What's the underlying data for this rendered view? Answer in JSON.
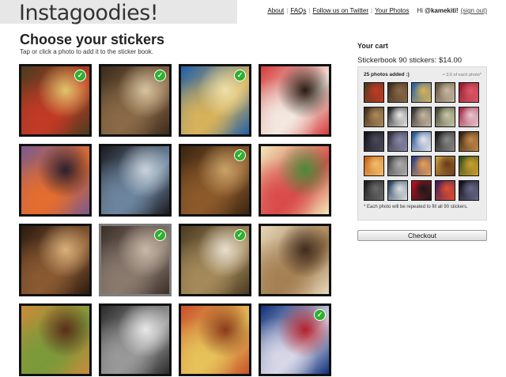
{
  "header": {
    "logo": "Instagoodies!",
    "nav": [
      {
        "label": "About"
      },
      {
        "label": "FAQs"
      },
      {
        "label": "Follow us on Twitter"
      },
      {
        "label": "Your Photos"
      }
    ],
    "greeting": "Hi ",
    "username": "@kamekiti!",
    "signout": "(sign out)"
  },
  "main": {
    "title": "Choose your stickers",
    "subtitle": "Tap or click a photo to add it to the sticker book."
  },
  "photos": [
    {
      "icon": "food-plate-photo",
      "colors": [
        "#4a3b1f",
        "#c23a25",
        "#e2c46b"
      ],
      "selected": true
    },
    {
      "icon": "people-street-photo",
      "colors": [
        "#3b2a1b",
        "#8a6a47",
        "#d8c3a0"
      ],
      "selected": true
    },
    {
      "icon": "blue-pen-box-photo",
      "colors": [
        "#1f5fa8",
        "#d8b35a",
        "#efe0a8"
      ],
      "selected": true
    },
    {
      "icon": "strawberry-dessert-photo",
      "colors": [
        "#d63a3a",
        "#f2e9e0",
        "#2a1a12"
      ],
      "selected": false
    },
    {
      "icon": "toy-figures-photo",
      "colors": [
        "#7b5a8c",
        "#e46d2e",
        "#2a1f2f"
      ],
      "selected": false
    },
    {
      "icon": "coffee-cup-photo",
      "colors": [
        "#1a1a20",
        "#6d86a0",
        "#c9d3dc"
      ],
      "selected": false
    },
    {
      "icon": "steak-dinner-photo",
      "colors": [
        "#3a2412",
        "#8d5a2a",
        "#c9a36a"
      ],
      "selected": true
    },
    {
      "icon": "floral-pattern-photo",
      "colors": [
        "#f1e9b8",
        "#d94a4a",
        "#4a8a3a"
      ],
      "selected": false
    },
    {
      "icon": "restaurant-interior-photo",
      "colors": [
        "#2b1a10",
        "#8a5a32",
        "#d9b07a"
      ],
      "selected": false
    },
    {
      "icon": "hallway-photo",
      "colors": [
        "#3a2e28",
        "#8a7a6e",
        "#c8b8a8"
      ],
      "selected": true
    },
    {
      "icon": "heart-note-photo",
      "colors": [
        "#4a3a22",
        "#a58a5a",
        "#e8e0d0"
      ],
      "selected": true
    },
    {
      "icon": "window-girl-photo",
      "colors": [
        "#e6d7b9",
        "#a47f52",
        "#3f2a1d"
      ],
      "selected": false
    },
    {
      "icon": "sandwich-photo",
      "colors": [
        "#c98b3b",
        "#7a9a3a",
        "#5a2e1a"
      ],
      "selected": false
    },
    {
      "icon": "light-pattern-photo",
      "colors": [
        "#2a2a2a",
        "#9a9a9a",
        "#e8e8e8"
      ],
      "selected": false
    },
    {
      "icon": "pasta-dish-photo",
      "colors": [
        "#c9502a",
        "#e6c25a",
        "#8a3a1a"
      ],
      "selected": false
    },
    {
      "icon": "pepsi-can-photo",
      "colors": [
        "#0d2f7a",
        "#d8d8e8",
        "#b3202a"
      ],
      "selected": true
    }
  ],
  "cart": {
    "title": "Your cart",
    "description": "Stickerbook 90 stickers: $14.00",
    "count": "25 photos added :)",
    "repeat_hint": "≈ 3.6 of each photo*",
    "note": "* Each photo will be repeated to fill all 90 stickers.",
    "checkout_label": "Checkout",
    "thumbs": [
      {
        "icon": "food-plate-thumb",
        "colors": [
          "#4a3b1f",
          "#c23a25"
        ]
      },
      {
        "icon": "people-street-thumb",
        "colors": [
          "#3b2a1b",
          "#8a6a47"
        ]
      },
      {
        "icon": "blue-pen-thumb",
        "colors": [
          "#1f5fa8",
          "#d8b35a"
        ]
      },
      {
        "icon": "street-thumb",
        "colors": [
          "#5a4a3a",
          "#c9b8a0"
        ]
      },
      {
        "icon": "red-drink-thumb",
        "colors": [
          "#8a1a2a",
          "#e05a6a"
        ]
      },
      {
        "icon": "table-thumb",
        "colors": [
          "#3a2a1a",
          "#b08a5a"
        ]
      },
      {
        "icon": "chalk-board-thumb",
        "colors": [
          "#1a1a1a",
          "#e8e8e8"
        ]
      },
      {
        "icon": "plate-thumb",
        "colors": [
          "#2a2a30",
          "#c8b8a0"
        ]
      },
      {
        "icon": "window-thumb",
        "colors": [
          "#3a3a2a",
          "#c8c8a8"
        ]
      },
      {
        "icon": "flowers-thumb",
        "colors": [
          "#a02040",
          "#e8c8d0"
        ]
      },
      {
        "icon": "dark-room-thumb",
        "colors": [
          "#101018",
          "#4a4a5a"
        ]
      },
      {
        "icon": "keyboard-thumb",
        "colors": [
          "#2a2a3a",
          "#8a8aa8"
        ]
      },
      {
        "icon": "sky-thumb",
        "colors": [
          "#1a4a8a",
          "#e8e8f0"
        ]
      },
      {
        "icon": "night-street-thumb",
        "colors": [
          "#101010",
          "#8a8a8a"
        ]
      },
      {
        "icon": "bar-thumb",
        "colors": [
          "#2a1a10",
          "#c88a4a"
        ]
      },
      {
        "icon": "orange-light-thumb",
        "colors": [
          "#c85a1a",
          "#f0c06a"
        ]
      },
      {
        "icon": "city-thumb",
        "colors": [
          "#3a3a3a",
          "#b0b0b0"
        ]
      },
      {
        "icon": "sunset-thumb",
        "colors": [
          "#1a3a8a",
          "#f0a050"
        ]
      },
      {
        "icon": "noodles-thumb",
        "colors": [
          "#c8a040",
          "#6a3a1a"
        ]
      },
      {
        "icon": "tree-thumb",
        "colors": [
          "#2a4a1a",
          "#d0a030"
        ]
      },
      {
        "icon": "skate-thumb",
        "colors": [
          "#1a1a1a",
          "#6a6a6a"
        ]
      },
      {
        "icon": "coast-thumb",
        "colors": [
          "#1a3a5a",
          "#e0e0e0"
        ]
      },
      {
        "icon": "soda-thumb",
        "colors": [
          "#c01020",
          "#1a1a1a"
        ]
      },
      {
        "icon": "neon-thumb",
        "colors": [
          "#3a1a5a",
          "#e05030"
        ]
      },
      {
        "icon": "evening-thumb",
        "colors": [
          "#0a0a10",
          "#6a6a8a"
        ]
      }
    ]
  }
}
